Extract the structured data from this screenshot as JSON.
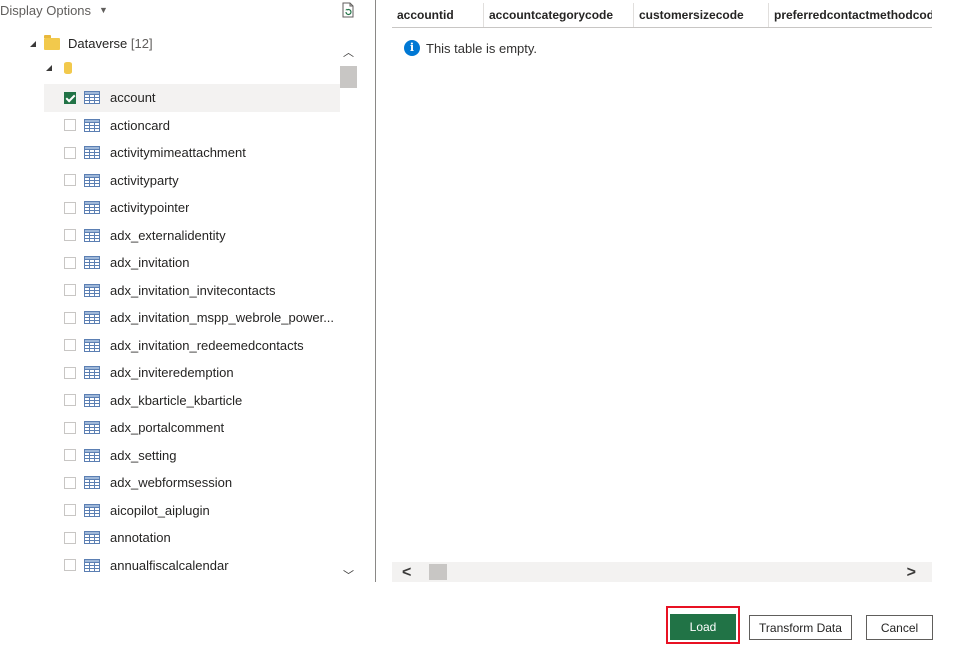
{
  "header": {
    "display_options_label": "Display Options",
    "refresh_icon": "refresh-file-icon"
  },
  "tree": {
    "root_label": "Dataverse",
    "root_count": "[12]",
    "items": [
      {
        "label": "account",
        "checked": true
      },
      {
        "label": "actioncard",
        "checked": false
      },
      {
        "label": "activitymimeattachment",
        "checked": false
      },
      {
        "label": "activityparty",
        "checked": false
      },
      {
        "label": "activitypointer",
        "checked": false
      },
      {
        "label": "adx_externalidentity",
        "checked": false
      },
      {
        "label": "adx_invitation",
        "checked": false
      },
      {
        "label": "adx_invitation_invitecontacts",
        "checked": false
      },
      {
        "label": "adx_invitation_mspp_webrole_power...",
        "checked": false
      },
      {
        "label": "adx_invitation_redeemedcontacts",
        "checked": false
      },
      {
        "label": "adx_inviteredemption",
        "checked": false
      },
      {
        "label": "adx_kbarticle_kbarticle",
        "checked": false
      },
      {
        "label": "adx_portalcomment",
        "checked": false
      },
      {
        "label": "adx_setting",
        "checked": false
      },
      {
        "label": "adx_webformsession",
        "checked": false
      },
      {
        "label": "aicopilot_aiplugin",
        "checked": false
      },
      {
        "label": "annotation",
        "checked": false
      },
      {
        "label": "annualfiscalcalendar",
        "checked": false
      }
    ]
  },
  "preview": {
    "columns": [
      "accountid",
      "accountcategorycode",
      "customersizecode",
      "preferredcontactmethodcode"
    ],
    "empty_message": "This table is empty."
  },
  "buttons": {
    "load": "Load",
    "transform": "Transform Data",
    "cancel": "Cancel"
  },
  "colors": {
    "accent_green": "#217346",
    "highlight_red": "#e81123",
    "info_blue": "#0078d4"
  }
}
